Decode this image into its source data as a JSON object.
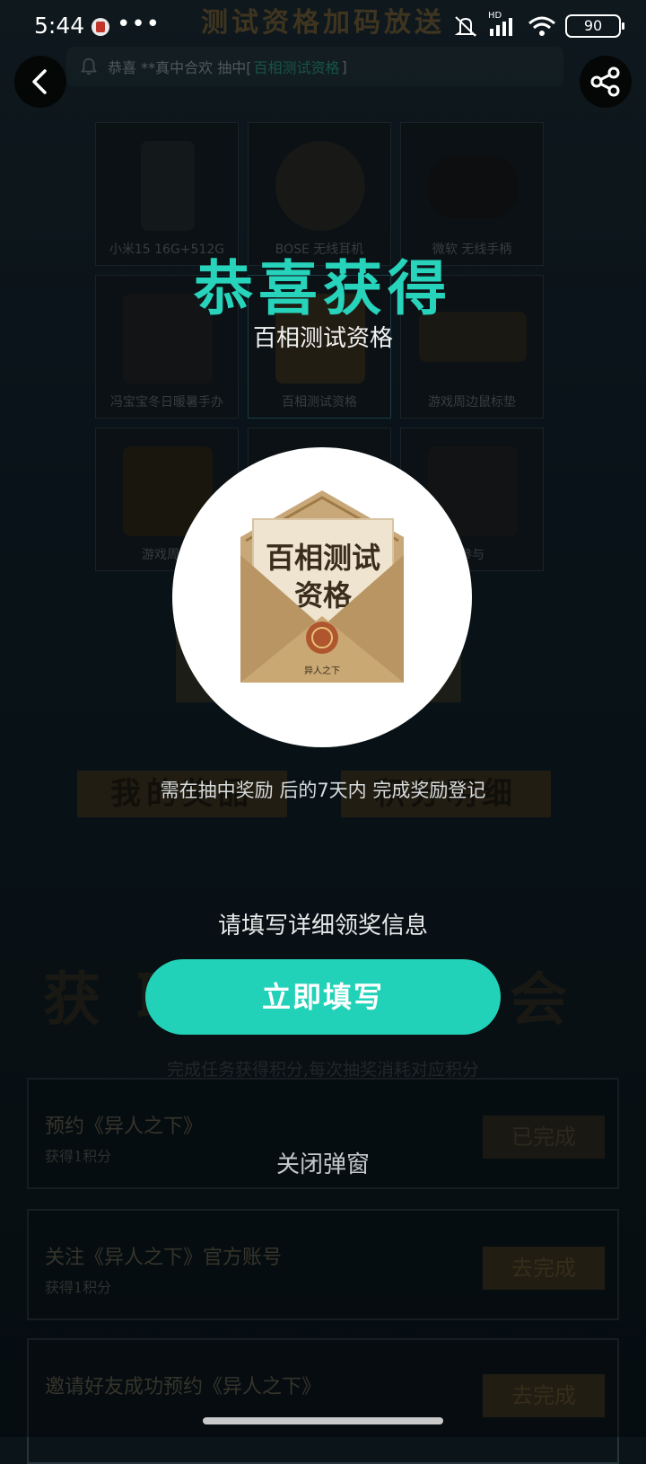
{
  "status_bar": {
    "time": "5:44",
    "more": "•••",
    "network": "HD",
    "battery": "90"
  },
  "background": {
    "title": "测试资格加码放送",
    "marquee": {
      "prefix": "恭喜",
      "user": "**真中合欢",
      "mid": "抽中[",
      "prize": "百相测试资格",
      "suffix": "]"
    },
    "prizes": [
      {
        "label": "小米15 16G+512G"
      },
      {
        "label": "BOSE 无线耳机"
      },
      {
        "label": "微软 无线手柄"
      },
      {
        "label": "冯宝宝冬日暖暑手办"
      },
      {
        "label": "百相测试资格"
      },
      {
        "label": "游戏周边鼠标垫"
      },
      {
        "label": "游戏周边"
      },
      {
        "label": ""
      },
      {
        "label": "参与"
      }
    ],
    "btn_left": "我的奖品",
    "btn_right": "积分明细",
    "section_title": "获取抽奖机会",
    "section_sub": "完成任务获得积分,每次抽奖消耗对应积分",
    "tasks": [
      {
        "title": "预约《异人之下》",
        "sub": "获得1积分",
        "btn": "已完成"
      },
      {
        "title": "关注《异人之下》官方账号",
        "sub": "获得1积分",
        "btn": "去完成"
      },
      {
        "title": "邀请好友成功预约《异人之下》",
        "sub": "",
        "btn": "去完成"
      }
    ]
  },
  "modal": {
    "headline": "恭喜获得",
    "prize_name": "百相测试资格",
    "envelope_text_line1": "百相测试",
    "envelope_text_line2": "资格",
    "envelope_footer": "异人之下",
    "note": "需在抽中奖励 后的7天内 完成奖励登记",
    "prompt": "请填写详细领奖信息",
    "fill_button": "立即填写",
    "close_label": "关闭弹窗"
  },
  "colors": {
    "accent": "#22d2b8",
    "headline": "#27d3bb"
  }
}
